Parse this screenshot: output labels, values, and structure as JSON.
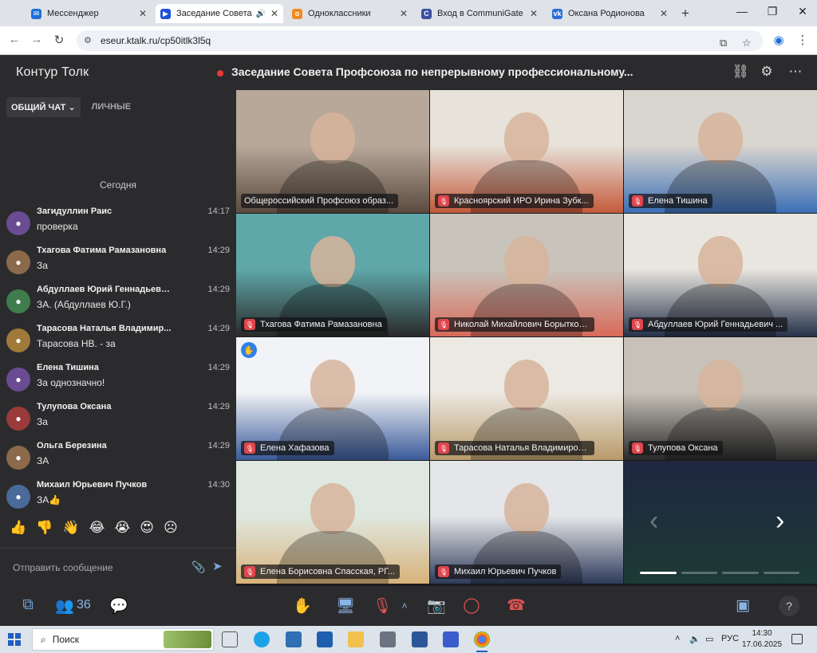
{
  "browser": {
    "tabs": [
      {
        "label": "Мессенджер",
        "icon_color": "#1e6fd9",
        "icon": "messenger-icon",
        "active": false
      },
      {
        "label": "Заседание Совета П",
        "icon_color": "#1d4fd8",
        "icon": "video-icon",
        "active": true
      },
      {
        "label": "Одноклассники",
        "icon_color": "#f28b1e",
        "icon": "ok-icon",
        "active": false
      },
      {
        "label": "Вход в CommuniGate Pro",
        "icon_color": "#3a4fa0",
        "icon": "communigate-icon",
        "active": false
      },
      {
        "label": "Оксана Родионова",
        "icon_color": "#2a6fd6",
        "icon": "vk-icon",
        "active": false
      }
    ],
    "url": "eseur.ktalk.ru/cp50itlk3l5q"
  },
  "app": {
    "brand": "Контур Толк",
    "meeting_title": "Заседание Совета Профсоюза по непрерывному профессиональному...",
    "recording_color": "#e53935"
  },
  "chat": {
    "tabs": [
      "ОБЩИЙ ЧАТ",
      "ЛИЧНЫЕ"
    ],
    "active_tab": "ОБЩИЙ ЧАТ",
    "day_label": "Сегодня",
    "messages": [
      {
        "name": "Загидуллин Раис",
        "time": "14:17",
        "text": "проверка",
        "avatar_color": "#6a4c93"
      },
      {
        "name": "Тхагова Фатима Рамазановна",
        "time": "14:29",
        "text": "За",
        "avatar_color": "#8a6a4a"
      },
      {
        "name": "Абдуллаев Юрий Геннадьеви...",
        "time": "14:29",
        "text": "ЗА. (Абдуллаев Ю.Г.)",
        "avatar_color": "#3f7d4f"
      },
      {
        "name": "Тарасова Наталья Владимир...",
        "time": "14:29",
        "text": "Тарасова НВ. - за",
        "avatar_color": "#a07a3a"
      },
      {
        "name": "Елена Тишина",
        "time": "14:29",
        "text": "За однозначно!",
        "avatar_color": "#6a4c93"
      },
      {
        "name": "Тулупова Оксана",
        "time": "14:29",
        "text": "За",
        "avatar_color": "#9a3a3a"
      },
      {
        "name": "Ольга Березина",
        "time": "14:29",
        "text": "ЗА",
        "avatar_color": "#8a6a4a"
      },
      {
        "name": "Михаил Юрьевич Пучков",
        "time": "14:30",
        "text": "ЗА👍",
        "avatar_color": "#4a6a9a"
      }
    ],
    "reactions": [
      "👍",
      "👎",
      "👋",
      "😂",
      "😭",
      "😍",
      "☹"
    ],
    "composer_placeholder": "Отправить сообщение"
  },
  "participants": [
    {
      "name": "Общероссийский Профсоюз образ...",
      "muted": false,
      "speaking": true,
      "scene": [
        "#b7a89a",
        "#5b4a3f"
      ]
    },
    {
      "name": "Красноярский ИРО Ирина Зубк...",
      "muted": true,
      "speaking": false,
      "scene": [
        "#e7e2da",
        "#c45a3a"
      ]
    },
    {
      "name": "Елена Тишина",
      "muted": true,
      "speaking": false,
      "scene": [
        "#d9d5cf",
        "#3b6fb6"
      ]
    },
    {
      "name": "Тхагова Фатима Рамазановна",
      "muted": true,
      "speaking": false,
      "scene": [
        "#5fa7a9",
        "#2a2a2a"
      ]
    },
    {
      "name": "Николай Михайлович Борытко, ...",
      "muted": true,
      "speaking": false,
      "scene": [
        "#c9c4bb",
        "#d86a5a"
      ]
    },
    {
      "name": "Абдуллаев Юрий Геннадьевич ...",
      "muted": true,
      "speaking": false,
      "scene": [
        "#e9e6e0",
        "#26324a"
      ]
    },
    {
      "name": "Елена Хафазова",
      "muted": true,
      "speaking": false,
      "scene": [
        "#f1f3f6",
        "#3a5a9a"
      ],
      "hand_raised": true
    },
    {
      "name": "Тарасова Наталья Владимировна",
      "muted": true,
      "speaking": false,
      "scene": [
        "#ece8e2",
        "#b89a6a"
      ]
    },
    {
      "name": "Тулупова Оксана",
      "muted": true,
      "speaking": false,
      "scene": [
        "#c7c1b8",
        "#2a2a2a"
      ]
    },
    {
      "name": "Елена Борисовна Спасская, РГ...",
      "muted": true,
      "speaking": false,
      "scene": [
        "#dfe8e0",
        "#d8b27a"
      ]
    },
    {
      "name": "Михаил Юрьевич Пучков",
      "muted": true,
      "speaking": false,
      "scene": [
        "#e5e6ea",
        "#2e3b5a"
      ]
    }
  ],
  "pager": {
    "pages": 4,
    "current": 1
  },
  "toolbar": {
    "participants_count": "36"
  },
  "taskbar": {
    "search_label": "Поиск",
    "language": "РУС",
    "time": "14:30",
    "date": "17.06.2025"
  }
}
